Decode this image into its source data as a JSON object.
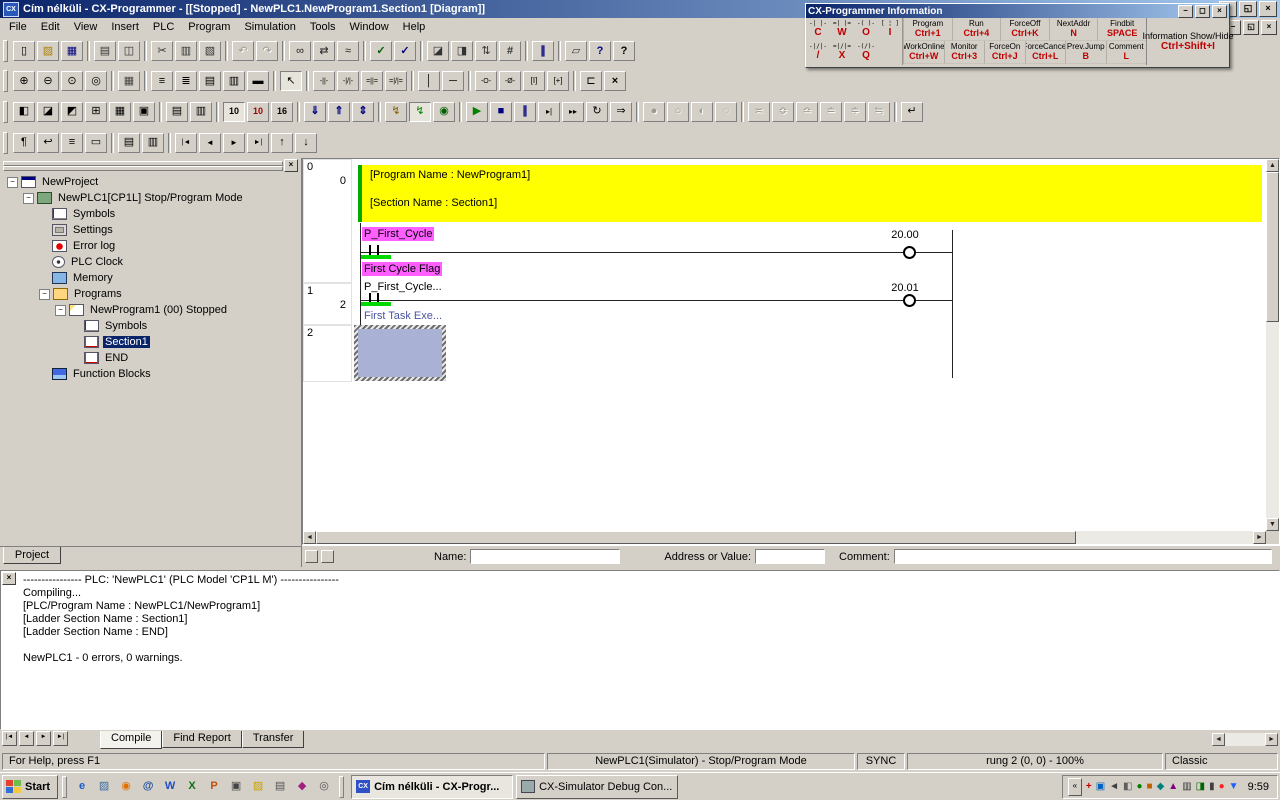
{
  "icons": {
    "minimize": "−",
    "maximize": "◻",
    "restore": "◱",
    "close": "×",
    "up": "▲",
    "down": "▼",
    "left": "◄",
    "right": "►",
    "tab_first": "|◄",
    "tab_prev": "◄",
    "tab_next": "►",
    "tab_last": "►|",
    "chevron": "«",
    "collapse": "−"
  },
  "window": {
    "title": "Cím nélküli - CX-Programmer - [[Stopped] - NewPLC1.NewProgram1.Section1 [Diagram]]"
  },
  "menu": {
    "items": [
      "File",
      "Edit",
      "View",
      "Insert",
      "PLC",
      "Program",
      "Simulation",
      "Tools",
      "Window",
      "Help"
    ]
  },
  "info_window": {
    "title": "CX-Programmer Information",
    "symbols": [
      {
        "glyph": "-| |-",
        "key": "C"
      },
      {
        "glyph": "=| |=",
        "key": "W"
      },
      {
        "glyph": "-( )-",
        "key": "O"
      },
      {
        "glyph": "[ ¦ ]",
        "key": "I"
      },
      {
        "glyph": "-|/|-",
        "key": "/"
      },
      {
        "glyph": "=|/|=",
        "key": "X"
      },
      {
        "glyph": "-(/)-",
        "key": "Q"
      }
    ],
    "shortcuts": [
      {
        "label": "Program",
        "key": "Ctrl+1"
      },
      {
        "label": "Run",
        "key": "Ctrl+4"
      },
      {
        "label": "ForceOff",
        "key": "Ctrl+K"
      },
      {
        "label": "NextAddr",
        "key": "N"
      },
      {
        "label": "Findbit",
        "key": "SPACE"
      },
      {
        "label": "WorkOnline",
        "key": "Ctrl+W"
      },
      {
        "label": "Monitor",
        "key": "Ctrl+3"
      },
      {
        "label": "ForceOn",
        "key": "Ctrl+J"
      },
      {
        "label": "ForceCancel",
        "key": "Ctrl+L"
      },
      {
        "label": "Prev.Jump",
        "key": "B"
      },
      {
        "label": "Comment",
        "key": "L"
      }
    ],
    "toggle": {
      "label": "Information Show/Hide",
      "key": "Ctrl+Shift+I"
    }
  },
  "toolbars": {
    "row1": [
      "~",
      {
        "n": "new-file",
        "g": "▯"
      },
      {
        "n": "open-file",
        "g": "▨",
        "c": "#b08000"
      },
      {
        "n": "save",
        "g": "▦",
        "c": "#000080"
      },
      "|",
      {
        "n": "print",
        "g": "▤",
        "c": "#333333"
      },
      {
        "n": "print-preview",
        "g": "◫",
        "c": "#333333"
      },
      "|",
      {
        "n": "cut",
        "g": "✂",
        "c": "#333333"
      },
      {
        "n": "copy",
        "g": "▥",
        "c": "#333333"
      },
      {
        "n": "paste",
        "g": "▧",
        "c": "#333333"
      },
      "|",
      {
        "n": "undo",
        "g": "↶",
        "d": true
      },
      {
        "n": "redo",
        "g": "↷",
        "d": true
      },
      "|",
      {
        "n": "find",
        "g": "∞",
        "c": "#222222"
      },
      {
        "n": "find-replace",
        "g": "⇄",
        "c": "#222222"
      },
      {
        "n": "find-bit",
        "g": "≈",
        "c": "#222222"
      },
      "|",
      {
        "n": "compile-program",
        "g": "✓",
        "c": "#006000",
        "b": true
      },
      {
        "n": "compile-all",
        "g": "✓",
        "c": "#000080",
        "b": true
      },
      "|",
      {
        "n": "watch-window",
        "g": "◪",
        "c": "#333333"
      },
      {
        "n": "output-window",
        "g": "◨",
        "c": "#333333"
      },
      {
        "n": "cross-reference",
        "g": "⇅",
        "c": "#333333"
      },
      {
        "n": "address-reference",
        "g": "#",
        "c": "#333333",
        "b": true
      },
      "|",
      {
        "n": "pause-monitoring",
        "g": "∥",
        "c": "#000080",
        "b": true
      },
      "|",
      {
        "n": "properties",
        "g": "▱",
        "c": "#333333"
      },
      {
        "n": "context-help",
        "g": "?",
        "c": "#000080",
        "b": true
      },
      {
        "n": "help",
        "g": "?",
        "c": "#000000",
        "b": true
      }
    ],
    "row2": [
      "~",
      {
        "n": "zoom-in",
        "g": "⊕"
      },
      {
        "n": "zoom-out",
        "g": "⊖"
      },
      {
        "n": "zoom-fit",
        "g": "⊙"
      },
      {
        "n": "zoom-100",
        "g": "◎"
      },
      "|",
      {
        "n": "toggle-grid",
        "g": "▦",
        "c": "#444444"
      },
      "|",
      {
        "n": "show-rung-comments",
        "g": "≡"
      },
      {
        "n": "show-io-comments",
        "g": "≣"
      },
      {
        "n": "show-rung-annotations",
        "g": "▤"
      },
      {
        "n": "show-monitor-data",
        "g": "▥"
      },
      {
        "n": "show-symbol-bar",
        "g": "▬"
      },
      "|",
      {
        "n": "select-tool",
        "g": "↖",
        "p": true
      },
      "|",
      {
        "n": "new-contact",
        "g": "-||-",
        "s": 7
      },
      {
        "n": "new-closed-contact",
        "g": "-|/|-",
        "s": 7
      },
      {
        "n": "new-or-contact",
        "g": "=||=",
        "s": 7
      },
      {
        "n": "new-closed-or-contact",
        "g": "=|/|=",
        "s": 7
      },
      "|",
      {
        "n": "vertical-line",
        "g": "│"
      },
      {
        "n": "horizontal-line",
        "g": "─"
      },
      "|",
      {
        "n": "new-coil",
        "g": "-O-",
        "s": 7
      },
      {
        "n": "new-closed-coil",
        "g": "-Ø-",
        "s": 7
      },
      {
        "n": "new-instruction",
        "g": "[I]",
        "s": 8
      },
      {
        "n": "instruction-detail",
        "g": "[+]",
        "s": 8
      },
      "|",
      {
        "n": "new-rung",
        "g": "⊏"
      },
      {
        "n": "delete-line",
        "g": "×",
        "b": true
      }
    ],
    "row3": [
      "~",
      {
        "n": "toggle-project-window",
        "g": "◧"
      },
      {
        "n": "toggle-output-window",
        "g": "◪"
      },
      {
        "n": "toggle-watch-sheet",
        "g": "◩"
      },
      {
        "n": "address-reference-tool",
        "g": "⊞"
      },
      {
        "n": "io-table",
        "g": "▦"
      },
      {
        "n": "plc-settings",
        "g": "▣"
      },
      "|",
      {
        "n": "symbol-table",
        "g": "▤"
      },
      {
        "n": "memory-view",
        "g": "▥"
      },
      "|",
      {
        "n": "monitor-decimal",
        "g": "10",
        "s": 9,
        "b": true,
        "p": true
      },
      {
        "n": "monitor-signed-decimal",
        "g": "10",
        "s": 9,
        "b": true,
        "c": "#a00000"
      },
      {
        "n": "monitor-hex",
        "g": "16",
        "s": 9,
        "b": true
      },
      "|",
      {
        "n": "download-to-plc",
        "g": "⇓",
        "c": "#000080",
        "b": true
      },
      {
        "n": "upload-from-plc",
        "g": "⇑",
        "c": "#000080",
        "b": true
      },
      {
        "n": "compare-with-plc",
        "g": "⇕",
        "c": "#000080",
        "b": true
      },
      "|",
      {
        "n": "work-online",
        "g": "↯",
        "c": "#806000"
      },
      {
        "n": "work-online-simulator",
        "g": "↯",
        "c": "#008000",
        "p": true
      },
      {
        "n": "monitor-mode",
        "g": "◉",
        "c": "#006000"
      },
      "|",
      {
        "n": "sim-run",
        "g": "▶",
        "c": "#008000"
      },
      {
        "n": "sim-stop",
        "g": "■",
        "c": "#000080"
      },
      {
        "n": "sim-pause",
        "g": "∥",
        "c": "#000080",
        "b": true
      },
      {
        "n": "step-run",
        "g": "▸|",
        "s": 8
      },
      {
        "n": "continuous-step",
        "g": "▸▸",
        "s": 8
      },
      {
        "n": "scan-run",
        "g": "↻"
      },
      {
        "n": "run-to-breakpoint",
        "g": "⇒"
      },
      "|",
      {
        "n": "set-breakpoint",
        "g": "●",
        "d": true
      },
      {
        "n": "clear-breakpoint",
        "g": "○",
        "d": true
      },
      {
        "n": "enable-breakpoints",
        "g": "◐",
        "d": true
      },
      {
        "n": "breakpoint-list",
        "g": "◌",
        "d": true
      },
      "|",
      {
        "n": "differential-monitor",
        "g": "≍",
        "d": true
      },
      {
        "n": "time-chart-monitor",
        "g": "≎",
        "d": true
      },
      {
        "n": "data-trace",
        "g": "≏",
        "d": true
      },
      {
        "n": "online-edit",
        "g": "≐",
        "d": true
      },
      {
        "n": "send-changes",
        "g": "≑",
        "d": true
      },
      {
        "n": "release-edit",
        "g": "≒",
        "d": true
      },
      "|",
      {
        "n": "return-to-caller",
        "g": "↵"
      }
    ],
    "row4": [
      "~",
      {
        "n": "edit-rung-comment",
        "g": "¶"
      },
      {
        "n": "wrap-rungs",
        "g": "↩"
      },
      {
        "n": "show-rung-dividers",
        "g": "≡"
      },
      {
        "n": "rung-properties",
        "g": "▭"
      },
      "|",
      {
        "n": "symbol-list",
        "g": "▤"
      },
      {
        "n": "local-symbol-table",
        "g": "▥"
      },
      "|",
      {
        "n": "go-first-rung",
        "g": "|◄",
        "s": 7
      },
      {
        "n": "go-prev-rung",
        "g": "◄",
        "s": 8
      },
      {
        "n": "go-next-rung",
        "g": "►",
        "s": 8
      },
      {
        "n": "go-last-rung",
        "g": "►|",
        "s": 7
      },
      {
        "n": "prev-bookmark",
        "g": "↑"
      },
      {
        "n": "next-bookmark",
        "g": "↓"
      }
    ]
  },
  "project_tree": {
    "tab": "Project",
    "items": [
      {
        "depth": 0,
        "label": "NewProject",
        "icon": "project",
        "expand": true
      },
      {
        "depth": 1,
        "label": "NewPLC1[CP1L] Stop/Program Mode",
        "icon": "plc",
        "expand": true
      },
      {
        "depth": 2,
        "label": "Symbols",
        "icon": "symbols"
      },
      {
        "depth": 2,
        "label": "Settings",
        "icon": "settings"
      },
      {
        "depth": 2,
        "label": "Error log",
        "icon": "errorlog"
      },
      {
        "depth": 2,
        "label": "PLC Clock",
        "icon": "clock"
      },
      {
        "depth": 2,
        "label": "Memory",
        "icon": "memory"
      },
      {
        "depth": 2,
        "label": "Programs",
        "icon": "programs",
        "expand": true
      },
      {
        "depth": 3,
        "label": "NewProgram1 (00) Stopped",
        "icon": "program",
        "expand": true
      },
      {
        "depth": 4,
        "label": "Symbols",
        "icon": "symbols"
      },
      {
        "depth": 4,
        "label": "Section1",
        "icon": "section",
        "selected": true
      },
      {
        "depth": 4,
        "label": "END",
        "icon": "section-end"
      },
      {
        "depth": 2,
        "label": "Function Blocks",
        "icon": "fb"
      }
    ]
  },
  "ladder": {
    "rungs": [
      {
        "rung": "0",
        "step": "0"
      },
      {
        "rung": "1",
        "step": "2"
      },
      {
        "rung": "2",
        "step": ""
      }
    ],
    "comment": {
      "line1": "[Program Name : NewProgram1]",
      "line2": "[Section Name : Section1]"
    },
    "rung0": {
      "contact": "P_First_Cycle",
      "comment": "First Cycle Flag",
      "coil": "20.00"
    },
    "rung1": {
      "contact": "P_First_Cycle...",
      "comment": "First Task Exe...",
      "coil": "20.01"
    }
  },
  "fields_bar": {
    "name_label": "Name:",
    "address_label": "Address or Value:",
    "comment_label": "Comment:"
  },
  "output": {
    "lines": [
      "---------------- PLC: 'NewPLC1' (PLC Model 'CP1L M') ----------------",
      "Compiling...",
      "[PLC/Program Name : NewPLC1/NewProgram1]",
      "[Ladder Section Name : Section1]",
      "[Ladder Section Name : END]",
      "",
      "NewPLC1 - 0 errors, 0 warnings."
    ],
    "tabs": [
      "Compile",
      "Find Report",
      "Transfer"
    ]
  },
  "status_bar": {
    "help": "For Help, press F1",
    "connection": "NewPLC1(Simulator) - Stop/Program Mode",
    "sync": "SYNC",
    "position": "rung 2 (0, 0) - 100%",
    "style": "Classic"
  },
  "taskbar": {
    "start": "Start",
    "quick_launch": [
      {
        "n": "internet-explorer",
        "g": "e",
        "c": "#1a5cc8",
        "b": true
      },
      {
        "n": "show-desktop",
        "g": "▨",
        "c": "#3A6EA5"
      },
      {
        "n": "media-player",
        "g": "◉",
        "c": "#e07000"
      },
      {
        "n": "mail",
        "g": "@",
        "c": "#2050a0",
        "b": true
      },
      {
        "n": "word",
        "g": "W",
        "c": "#2050c0",
        "b": true
      },
      {
        "n": "excel",
        "g": "X",
        "c": "#107010",
        "b": true
      },
      {
        "n": "powerpoint",
        "g": "P",
        "c": "#c05010",
        "b": true
      },
      {
        "n": "my-computer",
        "g": "▣",
        "c": "#444444"
      },
      {
        "n": "folder",
        "g": "▨",
        "c": "#c8a000"
      },
      {
        "n": "notepad",
        "g": "▤",
        "c": "#555555"
      },
      {
        "n": "paint",
        "g": "◆",
        "c": "#a02080"
      },
      {
        "n": "cd-player",
        "g": "◎",
        "c": "#555555"
      }
    ],
    "tasks": [
      {
        "label": "Cím nélküli - CX-Progr...",
        "active": true
      },
      {
        "label": "CX-Simulator Debug Con...",
        "active": false
      }
    ],
    "tray": [
      {
        "n": "tray-antivirus",
        "g": "+",
        "c": "#c00000",
        "b": true
      },
      {
        "n": "tray-network",
        "g": "▣",
        "c": "#0060c0"
      },
      {
        "n": "tray-volume",
        "g": "◄",
        "c": "#404040"
      },
      {
        "n": "tray-display",
        "g": "◧",
        "c": "#606060"
      },
      {
        "n": "tray-update",
        "g": "●",
        "c": "#008000"
      },
      {
        "n": "tray-firewall",
        "g": "■",
        "c": "#c06000"
      },
      {
        "n": "tray-messenger",
        "g": "◆",
        "c": "#008080"
      },
      {
        "n": "tray-scheduler",
        "g": "▲",
        "c": "#800080"
      },
      {
        "n": "tray-printer",
        "g": "▥",
        "c": "#333333"
      },
      {
        "n": "tray-usb",
        "g": "◨",
        "c": "#006600"
      },
      {
        "n": "tray-battery",
        "g": "▮",
        "c": "#404040"
      },
      {
        "n": "tray-alert",
        "g": "●",
        "c": "#ff2020"
      },
      {
        "n": "tray-sync",
        "g": "▼",
        "c": "#2060ff"
      }
    ],
    "clock": "9:59"
  }
}
